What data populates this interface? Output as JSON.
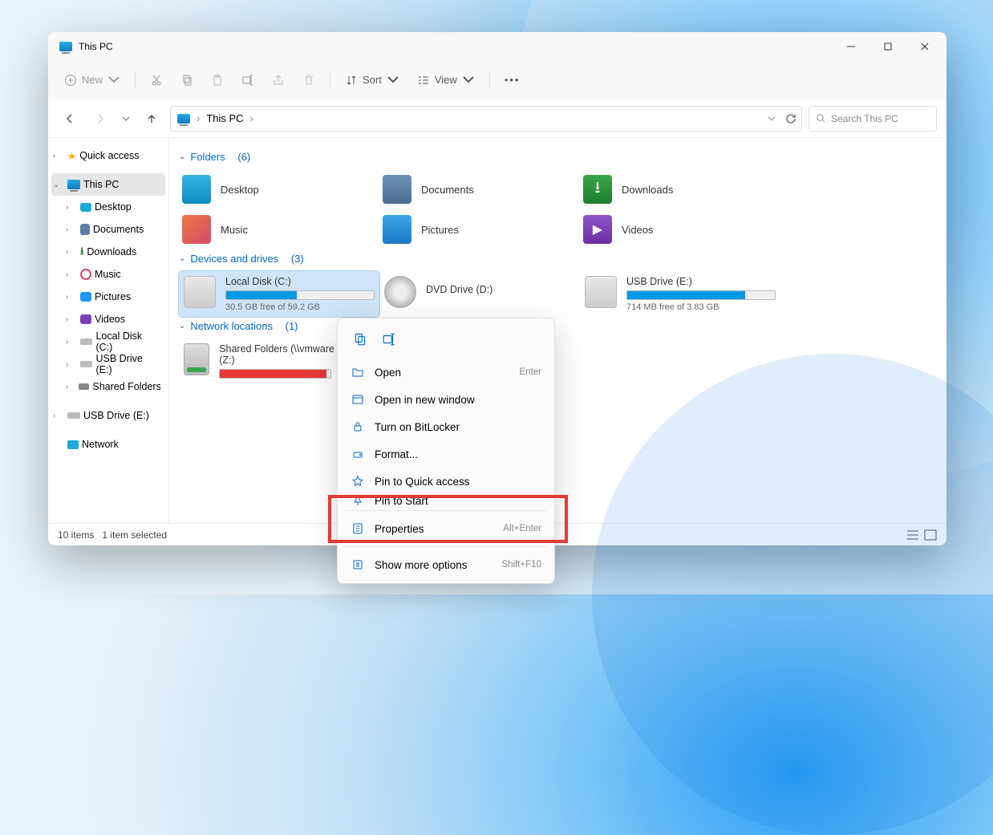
{
  "title": "This PC",
  "toolbar": {
    "new": "New",
    "sort": "Sort",
    "view": "View"
  },
  "breadcrumb": [
    "This PC"
  ],
  "search_placeholder": "Search This PC",
  "sidebar": {
    "quick_access": "Quick access",
    "this_pc": "This PC",
    "items": [
      {
        "label": "Desktop"
      },
      {
        "label": "Documents"
      },
      {
        "label": "Downloads"
      },
      {
        "label": "Music"
      },
      {
        "label": "Pictures"
      },
      {
        "label": "Videos"
      },
      {
        "label": "Local Disk (C:)"
      },
      {
        "label": "USB Drive (E:)"
      },
      {
        "label": "Shared Folders (\\\\"
      }
    ],
    "usb": "USB Drive (E:)",
    "network": "Network"
  },
  "sections": {
    "folders": {
      "title": "Folders",
      "count": "(6)"
    },
    "drives": {
      "title": "Devices and drives",
      "count": "(3)"
    },
    "network": {
      "title": "Network locations",
      "count": "(1)"
    }
  },
  "folders": [
    {
      "label": "Desktop",
      "color": "#1fa8d8"
    },
    {
      "label": "Documents",
      "color": "#5b7fa6"
    },
    {
      "label": "Downloads",
      "color": "#2e7d32"
    },
    {
      "label": "Music",
      "color": "#d14b6b"
    },
    {
      "label": "Pictures",
      "color": "#2196f3"
    },
    {
      "label": "Videos",
      "color": "#7b3fb5"
    }
  ],
  "drives": [
    {
      "label": "Local Disk (C:)",
      "sub": "30.5 GB free of 59.2 GB",
      "fill": 48,
      "color": "#0099e5"
    },
    {
      "label": "DVD Drive (D:)",
      "sub": "",
      "fill": 0,
      "color": "#888",
      "nobardisplay": true
    },
    {
      "label": "USB Drive (E:)",
      "sub": "714 MB free of 3.83 GB",
      "fill": 80,
      "color": "#0099e5"
    }
  ],
  "network_items": [
    {
      "label": "Shared Folders (\\\\vmware",
      "label2": "(Z:)",
      "fill": 96,
      "color": "#e53935"
    }
  ],
  "status": {
    "items": "10 items",
    "selected": "1 item selected"
  },
  "context": {
    "open": "Open",
    "open_hint": "Enter",
    "open_new": "Open in new window",
    "bitlocker": "Turn on BitLocker",
    "format": "Format...",
    "pin_qa": "Pin to Quick access",
    "pin_start": "Pin to Start",
    "properties": "Properties",
    "properties_hint": "Alt+Enter",
    "more": "Show more options",
    "more_hint": "Shift+F10"
  }
}
